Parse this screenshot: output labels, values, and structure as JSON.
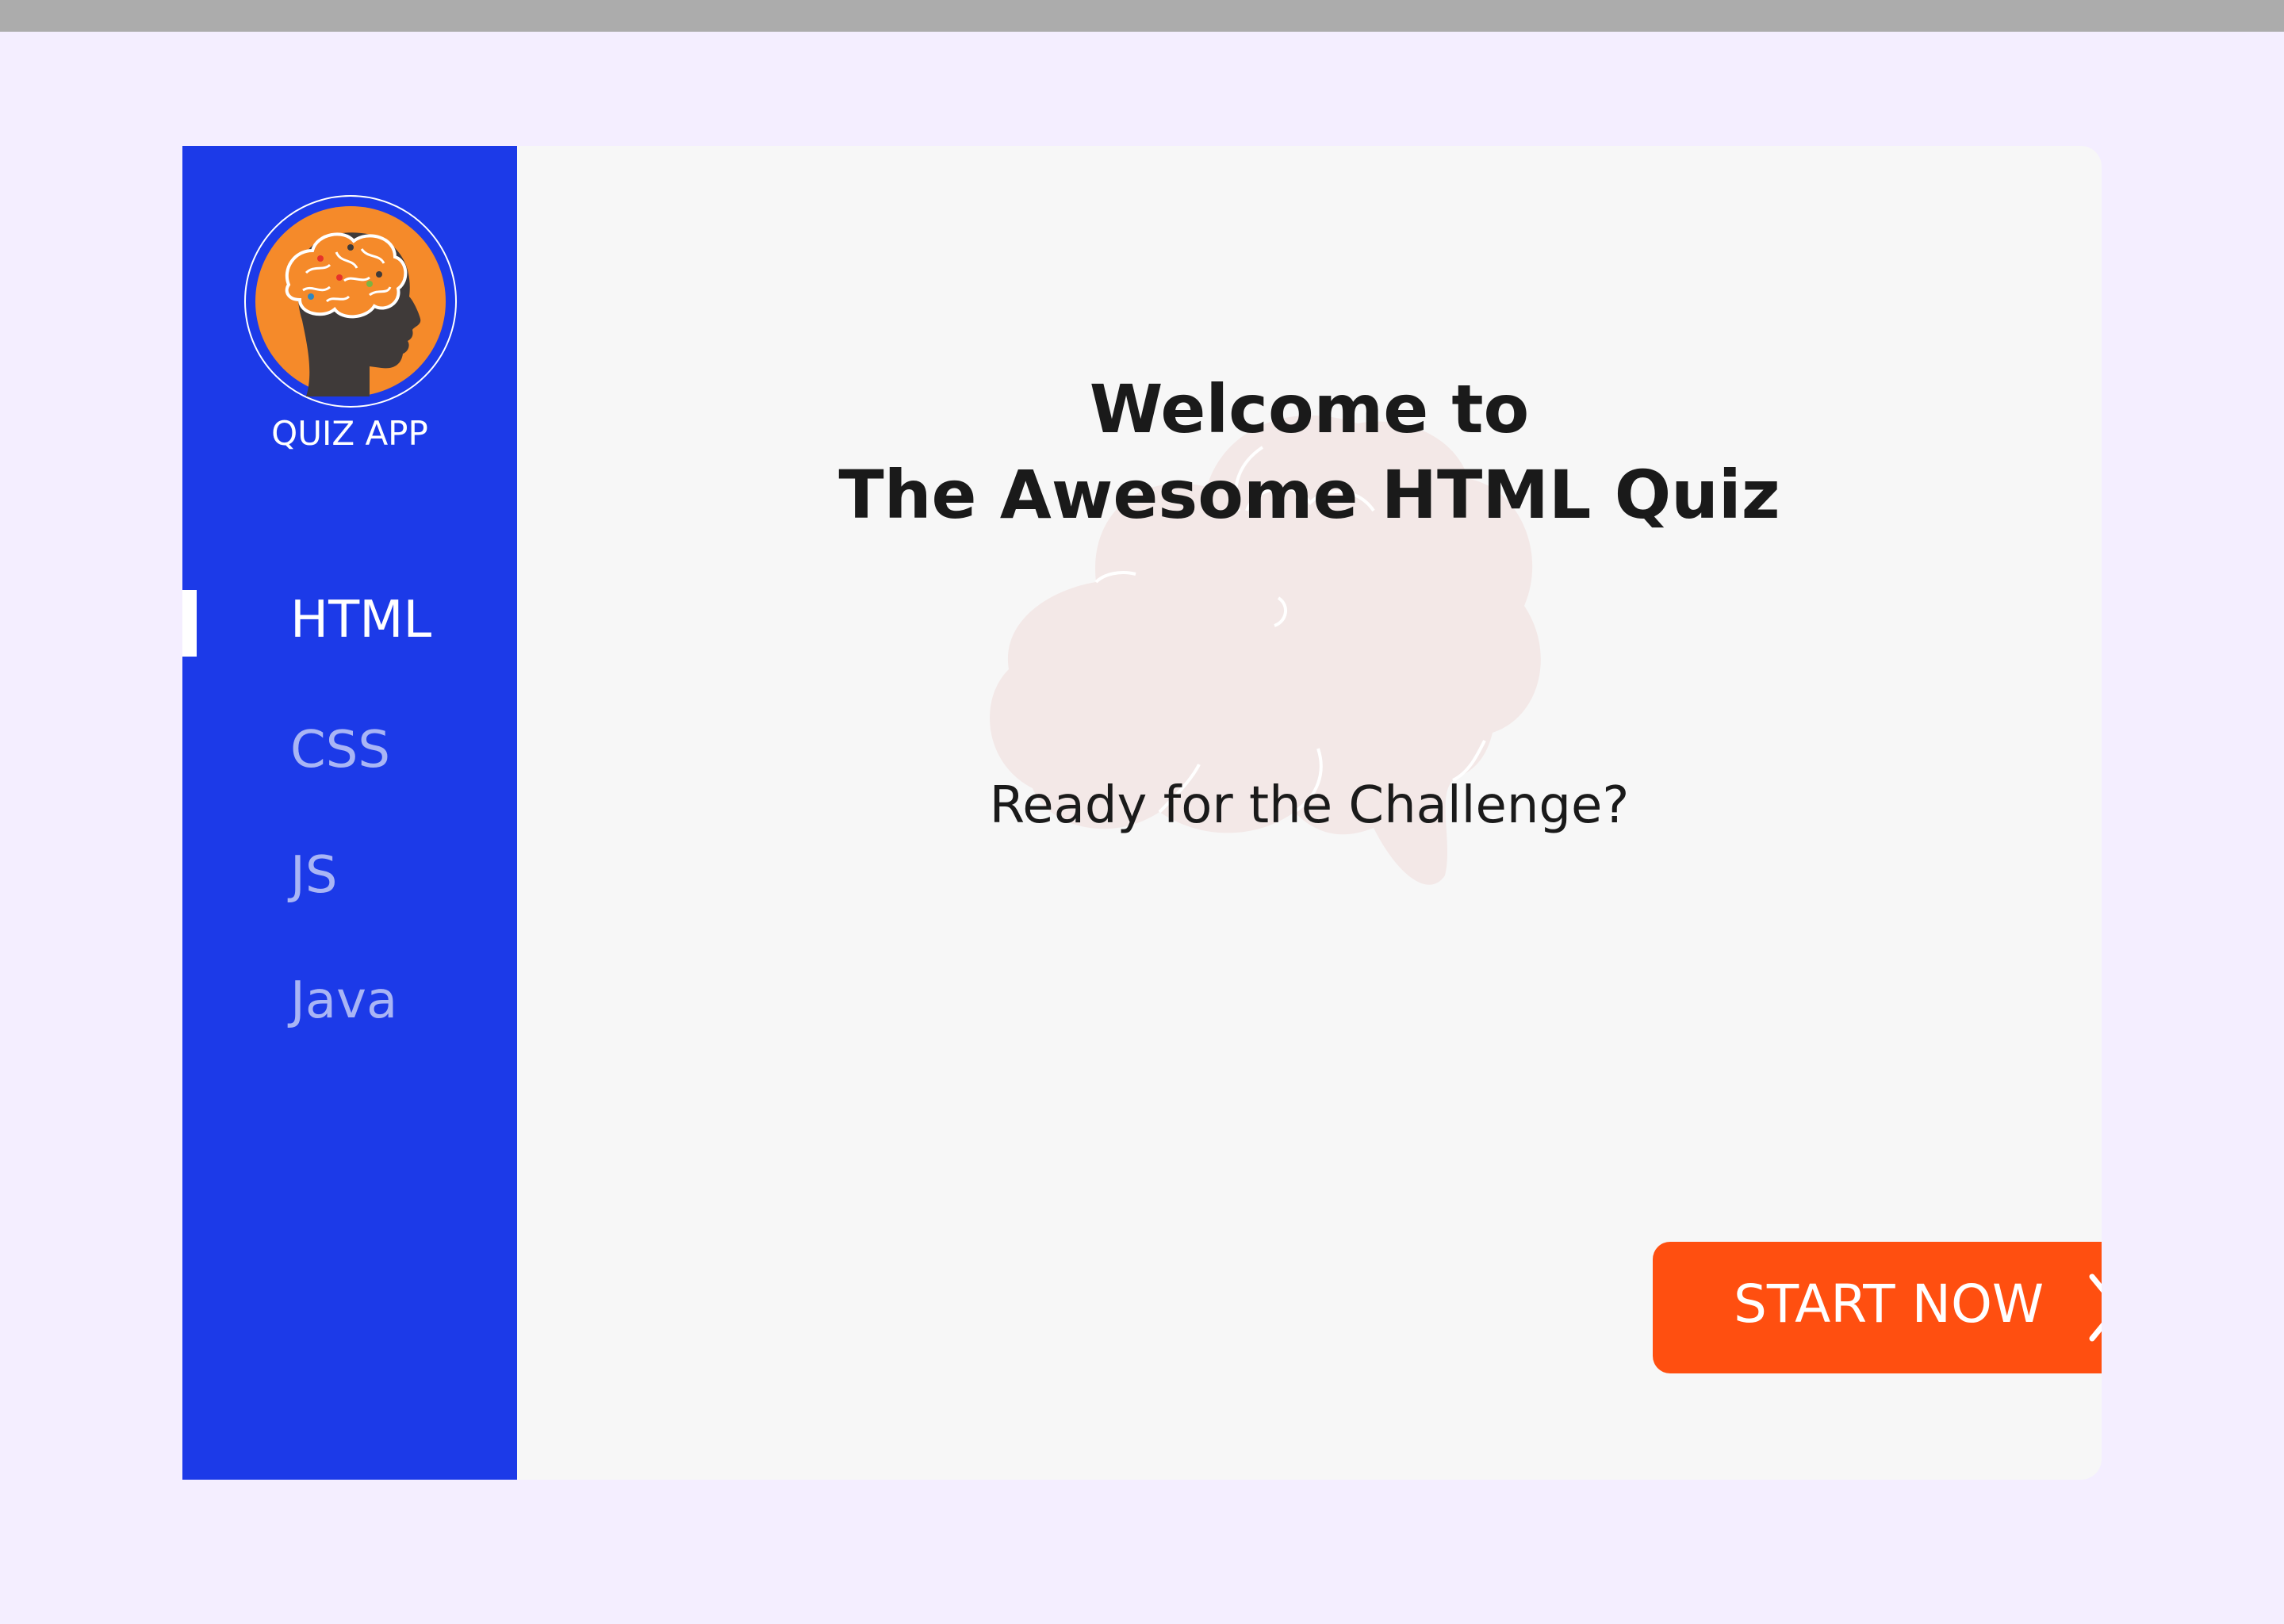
{
  "app": {
    "logo_text": "QUIZ APP"
  },
  "sidebar": {
    "items": [
      {
        "label": "HTML",
        "active": true
      },
      {
        "label": "CSS",
        "active": false
      },
      {
        "label": "JS",
        "active": false
      },
      {
        "label": "Java",
        "active": false
      }
    ]
  },
  "main": {
    "title_line1": "Welcome to",
    "title_line2": "The Awesome HTML Quiz",
    "subtitle": "Ready for the Challenge?",
    "start_button": {
      "label": "START NOW",
      "icon": "chevron-right-icon"
    }
  },
  "colors": {
    "page_background": "#F4EEFF",
    "sidebar": "#1C3AE8",
    "content_background": "#F7F7F7",
    "accent": "#FF4F10",
    "logo_orange": "#F58A2A",
    "head_silhouette": "#3F3A39",
    "inactive_nav": "#A9B5F5"
  }
}
